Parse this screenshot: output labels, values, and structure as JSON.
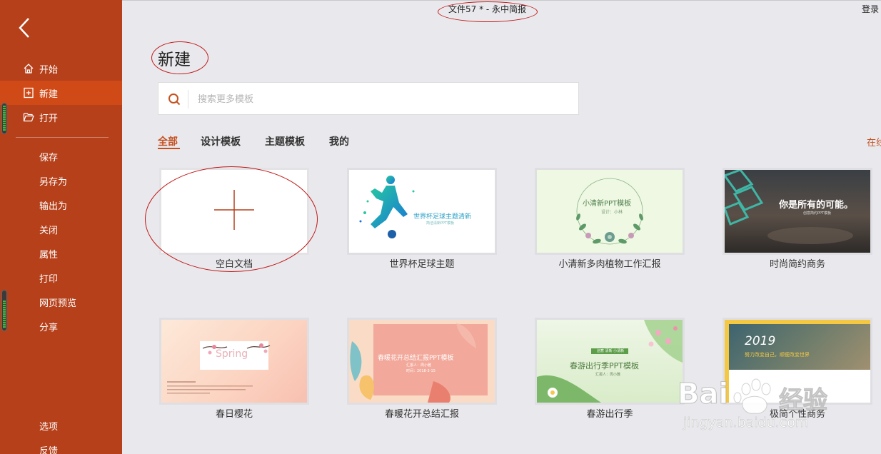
{
  "window": {
    "title": "文件57 * - 永中简报",
    "login_label": "登录"
  },
  "sidebar": {
    "back_icon": "back-arrow-icon",
    "items": [
      {
        "label": "开始",
        "icon": "home-icon"
      },
      {
        "label": "新建",
        "icon": "new-doc-icon",
        "active": true
      },
      {
        "label": "打开",
        "icon": "folder-open-icon"
      }
    ],
    "actions": [
      {
        "label": "保存"
      },
      {
        "label": "另存为"
      },
      {
        "label": "输出为"
      },
      {
        "label": "关闭"
      },
      {
        "label": "属性"
      },
      {
        "label": "打印"
      },
      {
        "label": "网页预览"
      },
      {
        "label": "分享"
      }
    ],
    "footer": [
      {
        "label": "选项"
      },
      {
        "label": "反馈"
      }
    ],
    "colors": {
      "background": "#b5401a",
      "active": "#d04a17"
    }
  },
  "main": {
    "title": "新建",
    "search": {
      "placeholder": "搜索更多模板",
      "value": ""
    },
    "tabs": [
      {
        "label": "全部",
        "active": true
      },
      {
        "label": "设计模板"
      },
      {
        "label": "主题模板"
      },
      {
        "label": "我的"
      }
    ],
    "right_link": "在线",
    "accent_color": "#c5501f",
    "templates": [
      {
        "name": "空白文档",
        "thumb": {}
      },
      {
        "name": "世界杯足球主题",
        "thumb": {
          "title": "世界杯足球主题清新",
          "subtitle": "简洁清新PPT模板"
        }
      },
      {
        "name": "小清新多肉植物工作汇报",
        "thumb": {
          "title": "小清新PPT模板",
          "subtitle": "设计：小林"
        }
      },
      {
        "name": "时尚简约商务",
        "thumb": {
          "title": "你是所有的可能。",
          "subtitle": "创意简约PPT模板"
        }
      },
      {
        "name": "春日樱花",
        "thumb": {
          "title": "Spring"
        }
      },
      {
        "name": "春暖花开总结汇报",
        "thumb": {
          "title": "春暖花开总结汇报PPT模板",
          "subtitle": "汇报人：周小雅",
          "date": "时间：2018-3-15"
        }
      },
      {
        "name": "春游出行季",
        "thumb": {
          "title": "春游出行季PPT模板",
          "subtitle": "汇报人：周小雅",
          "badge": "创意 清新 小清新"
        }
      },
      {
        "name": "极简个性商务",
        "thumb": {
          "title": "2019",
          "subtitle": "努力改变自己，顺便改变世界"
        }
      }
    ]
  },
  "watermark": {
    "brand": "Bai",
    "brand_cn": "经验",
    "url": "jingyan.baidu.com"
  }
}
